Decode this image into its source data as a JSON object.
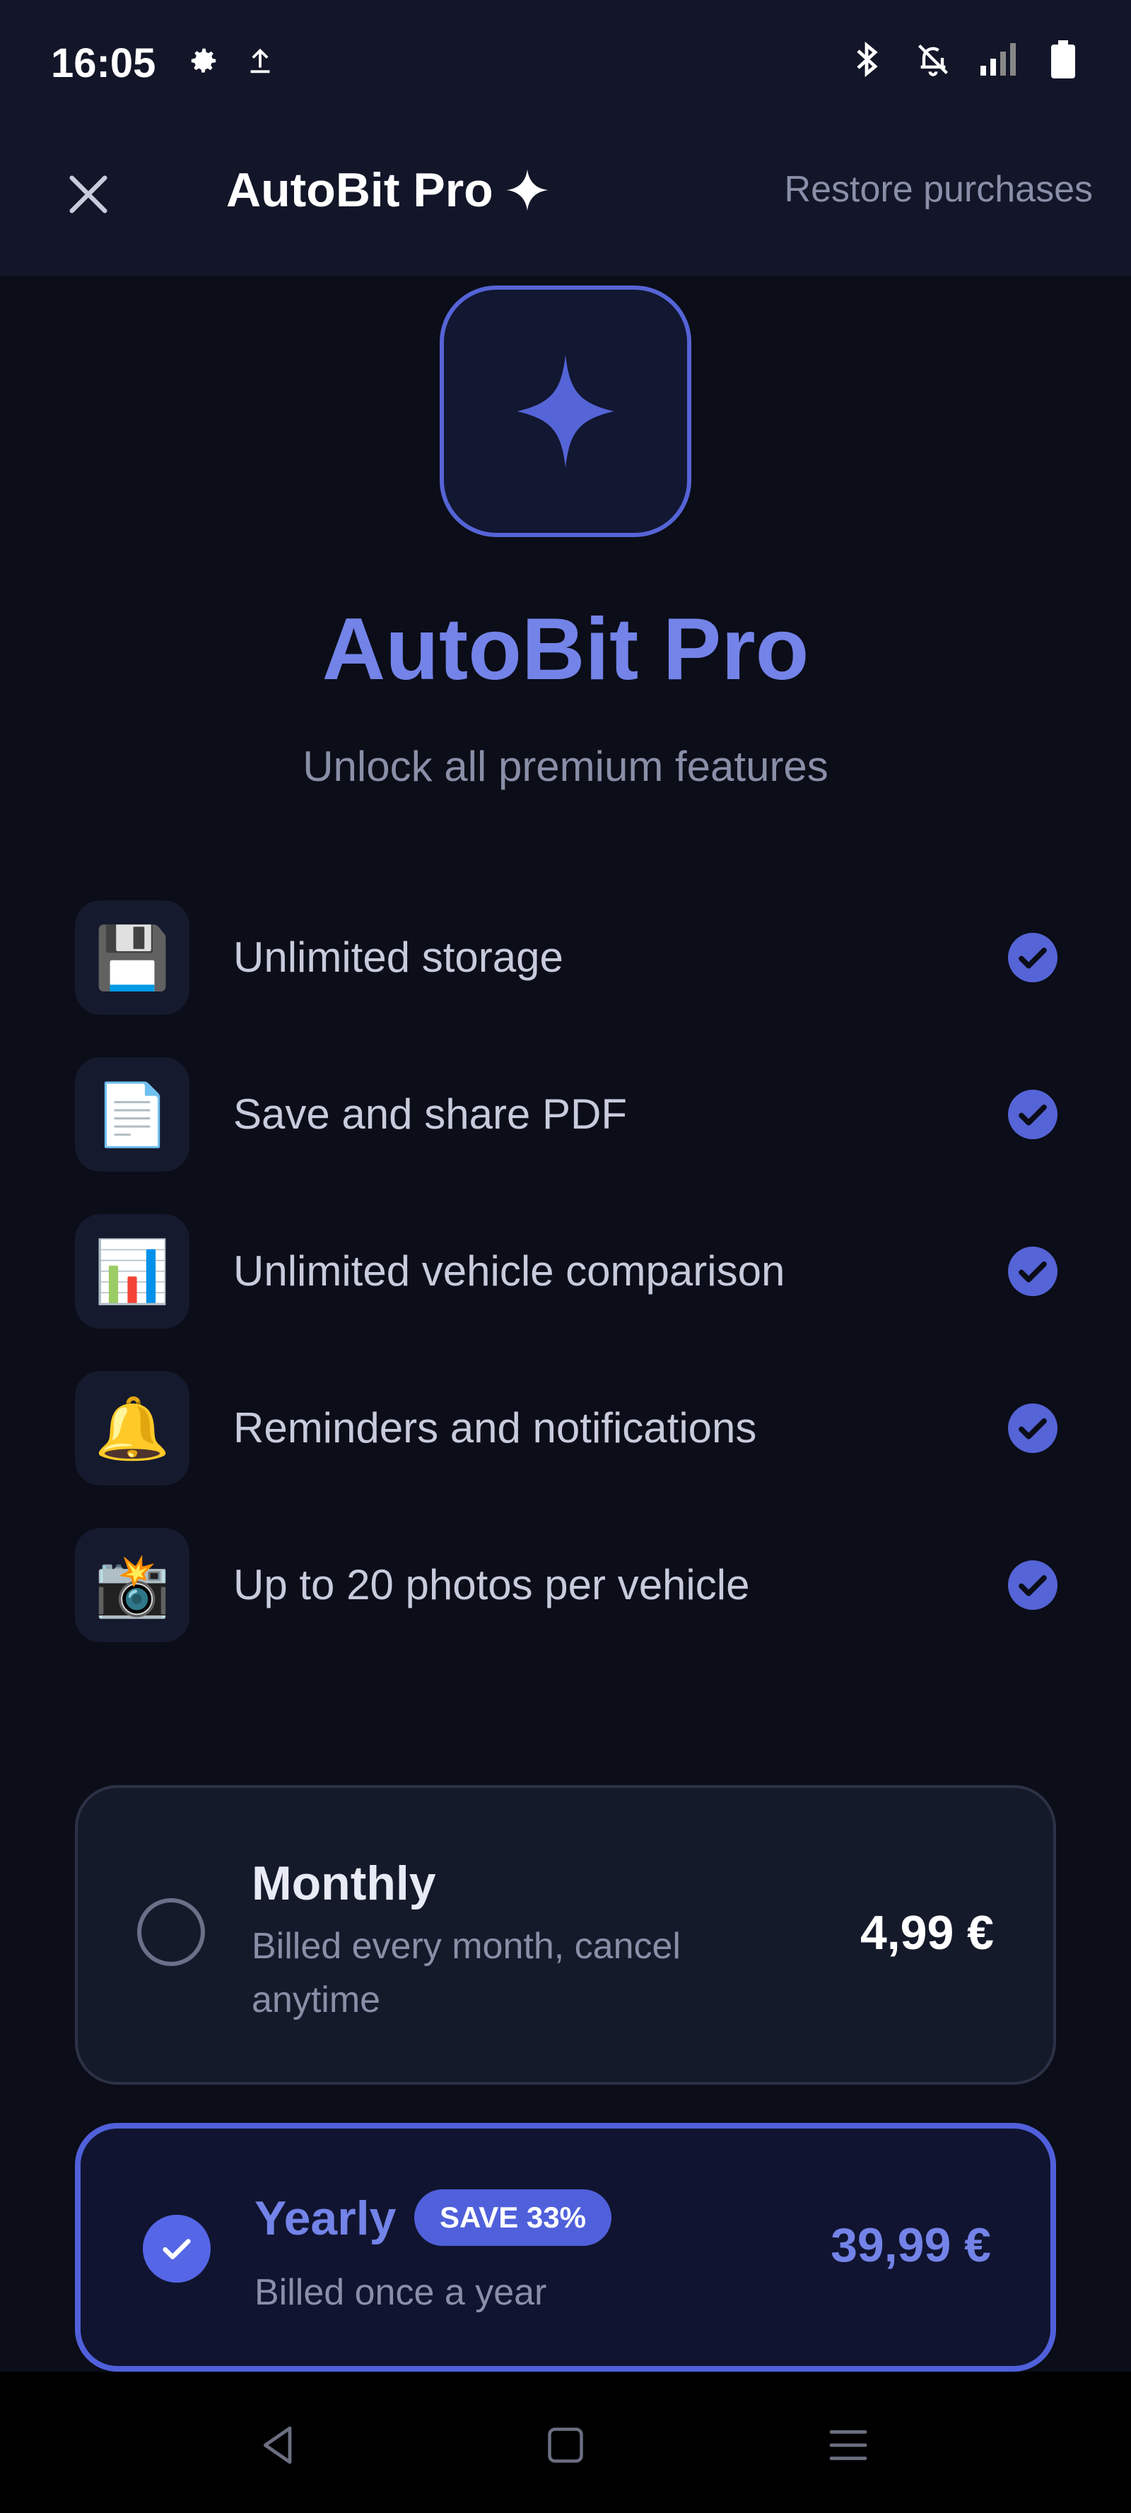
{
  "status_bar": {
    "time": "16:05",
    "left_icons": [
      "settings-icon",
      "upload-icon"
    ],
    "right_icons": [
      "bluetooth-icon",
      "notifications-off-icon",
      "signal-icon",
      "battery-icon"
    ]
  },
  "app_bar": {
    "title": "AutoBit Pro",
    "title_icon": "sparkle-icon",
    "close_icon": "close-icon",
    "restore_label": "Restore purchases"
  },
  "hero": {
    "icon": "sparkle-icon",
    "title": "AutoBit Pro",
    "subtitle": "Unlock all premium features"
  },
  "features": [
    {
      "emoji": "💾",
      "icon": "floppy-disk-icon",
      "label": "Unlimited storage"
    },
    {
      "emoji": "📄",
      "icon": "document-icon",
      "label": "Save and share PDF"
    },
    {
      "emoji": "📊",
      "icon": "bar-chart-icon",
      "label": "Unlimited vehicle comparison"
    },
    {
      "emoji": "🔔",
      "icon": "bell-icon",
      "label": "Reminders and notifications"
    },
    {
      "emoji": "📸",
      "icon": "camera-icon",
      "label": "Up to 20 photos per vehicle"
    }
  ],
  "plans": {
    "monthly": {
      "name": "Monthly",
      "description": "Billed every month, cancel anytime",
      "price": "4,99 €",
      "selected": false
    },
    "yearly": {
      "name": "Yearly",
      "badge": "SAVE 33%",
      "description": "Billed once a year",
      "price": "39,99 €",
      "selected": true
    }
  },
  "nav_bar": {
    "items": [
      "back-icon",
      "home-icon",
      "menu-icon"
    ]
  },
  "colors": {
    "background": "#0b0d18",
    "surface": "#121628",
    "accent": "#5564d6",
    "accent_text": "#7383e8",
    "muted_text": "#8a8fa8"
  }
}
